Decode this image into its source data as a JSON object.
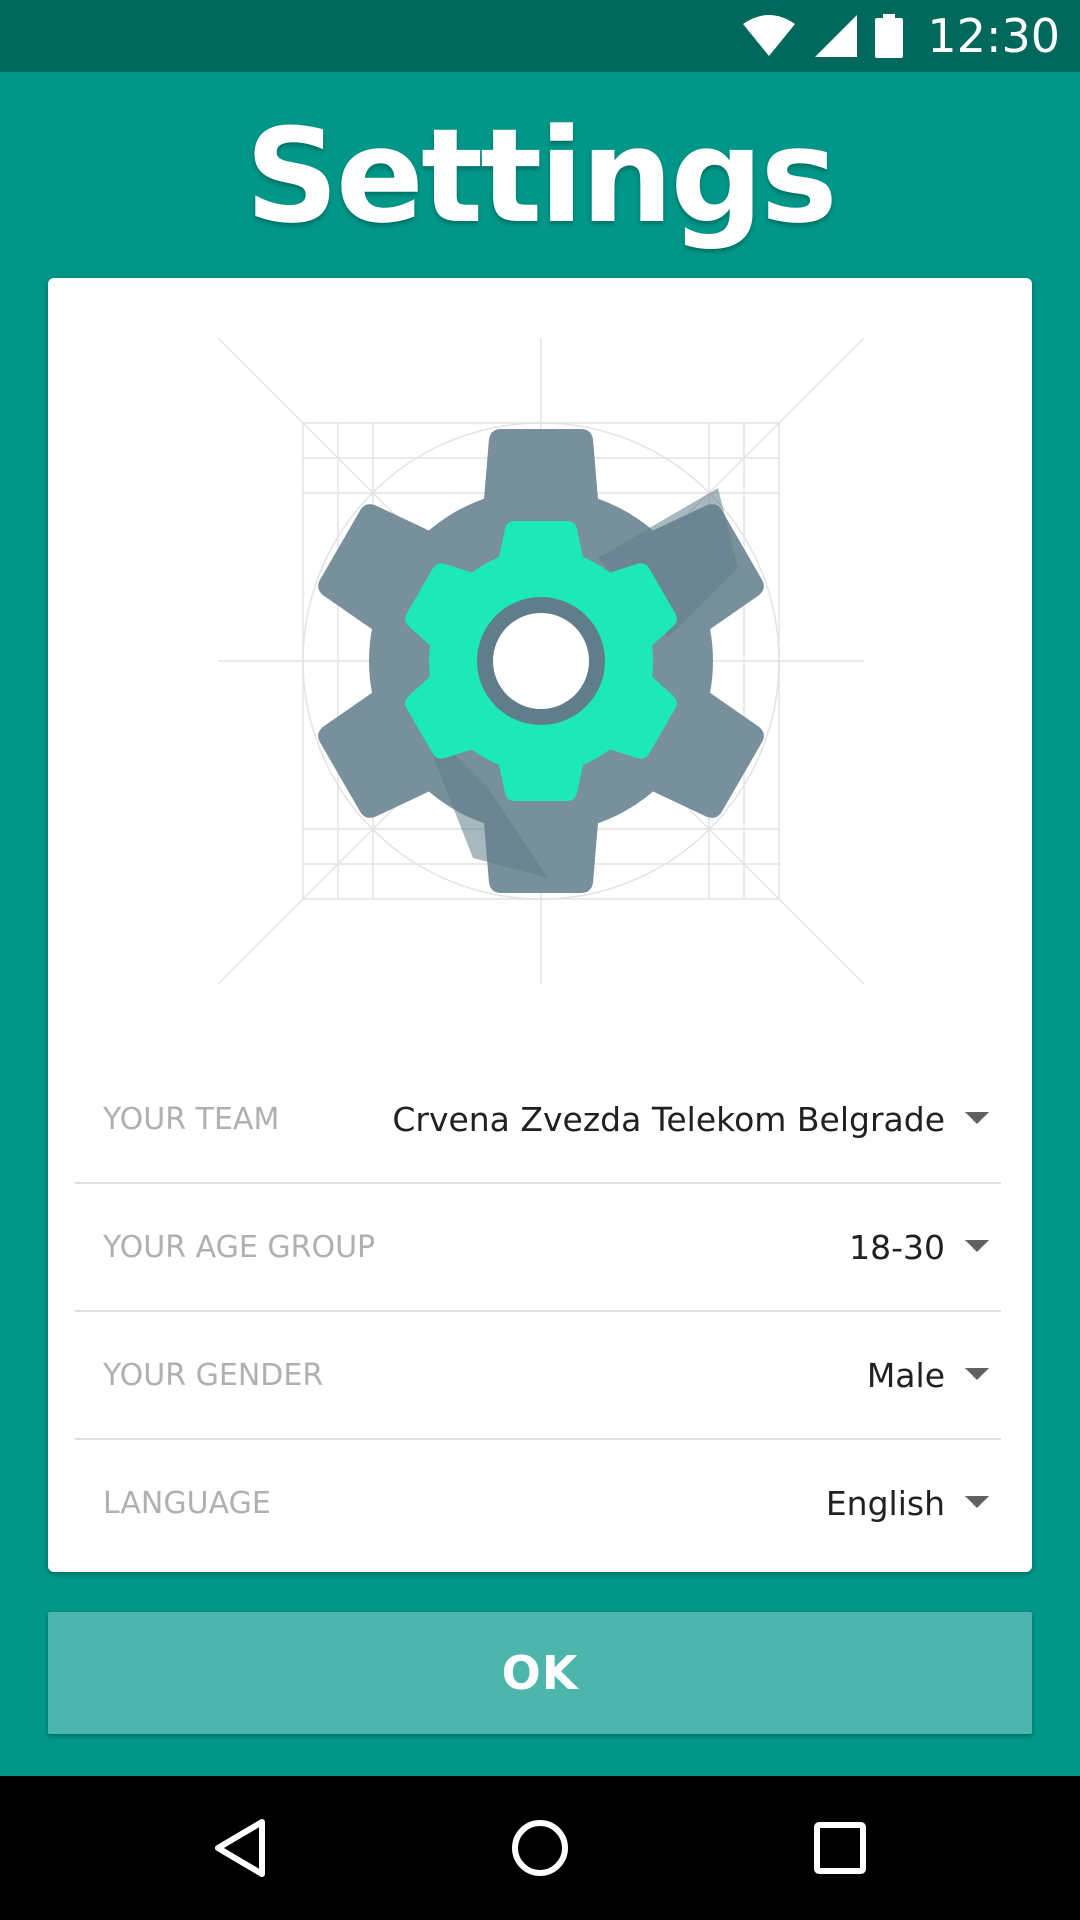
{
  "status_bar": {
    "time": "12:30",
    "icons": [
      "wifi-icon",
      "cell-signal-icon",
      "battery-icon"
    ]
  },
  "title": "Settings",
  "illustration": {
    "icon": "gear-icon",
    "colors": {
      "gear_outer": "#78909c",
      "gear_inner": "#1de9b6"
    }
  },
  "settings": [
    {
      "label": "YOUR TEAM",
      "value": "Crvena Zvezda Telekom Belgrade"
    },
    {
      "label": "YOUR AGE GROUP",
      "value": "18-30"
    },
    {
      "label": "YOUR GENDER",
      "value": "Male"
    },
    {
      "label": "LANGUAGE",
      "value": "English"
    }
  ],
  "ok_label": "OK",
  "nav_bar": {
    "icons": [
      "back-icon",
      "home-icon",
      "recents-icon"
    ]
  },
  "colors": {
    "background": "#009688",
    "status_bar": "#00695c",
    "button": "#4db6ac"
  }
}
